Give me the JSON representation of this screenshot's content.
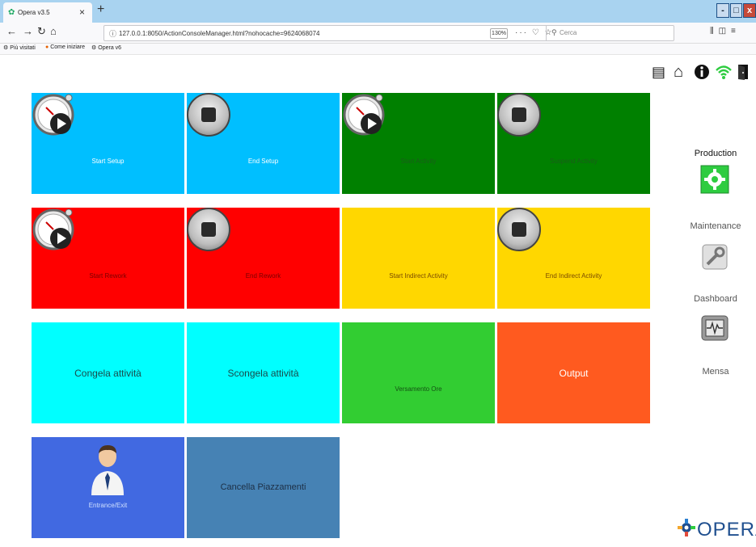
{
  "browser": {
    "tab_title": "Opera v3.5",
    "tab_close": "×",
    "tab_new": "+",
    "window_controls": [
      "-",
      "□",
      "x"
    ],
    "url": "127.0.0.1:8050/ActionConsoleManager.html?nohocache=9624068074",
    "zoom": "130%",
    "url_icons": "··· ♡ ☆",
    "search_placeholder": "Cerca",
    "bookmarks": [
      {
        "label": "Più visitati",
        "icon": "gear-icon"
      },
      {
        "label": "Come iniziare",
        "icon": "firefox-icon"
      },
      {
        "label": "Opera v6",
        "icon": "opera-icon"
      }
    ]
  },
  "top_icons": [
    "note-icon",
    "home-icon",
    "info-icon",
    "wifi-icon",
    "exit-door-icon"
  ],
  "tiles": [
    {
      "label": "Start Setup",
      "color": "#00bfff",
      "icon": "clock-play-icon"
    },
    {
      "label": "End Setup",
      "color": "#00bfff",
      "icon": "stop-icon"
    },
    {
      "label": "Start Activity",
      "color": "#008000",
      "icon": "clock-play-icon"
    },
    {
      "label": "Suspend Activity",
      "color": "#008000",
      "icon": "stop-icon"
    },
    {
      "label": "Start Rework",
      "color": "#ff0000",
      "icon": "clock-play-icon"
    },
    {
      "label": "End Rework",
      "color": "#ff0000",
      "icon": "stop-icon"
    },
    {
      "label": "Start Indirect Activity",
      "color": "#ffd700",
      "icon": ""
    },
    {
      "label": "End Indirect Activity",
      "color": "#ffd700",
      "icon": "stop-icon"
    },
    {
      "label": "Congela attività",
      "color": "#00ffff",
      "icon": ""
    },
    {
      "label": "Scongela attività",
      "color": "#00ffff",
      "icon": ""
    },
    {
      "label": "Versamento Ore",
      "color": "#32cd32",
      "icon": ""
    },
    {
      "label": "Output",
      "color": "#ff5a1f",
      "icon": ""
    },
    {
      "label": "Entrance/Exit",
      "color": "#4169e1",
      "icon": "person-icon"
    },
    {
      "label": "Cancella Piazzamenti",
      "color": "#4682b4",
      "icon": ""
    }
  ],
  "side_menu": [
    {
      "label": "Production",
      "icon": "gear-icon",
      "active": true
    },
    {
      "label": "Maintenance",
      "icon": "wrench-icon",
      "active": false
    },
    {
      "label": "Dashboard",
      "icon": "monitor-icon",
      "active": false
    },
    {
      "label": "Mensa",
      "icon": "",
      "active": false
    }
  ],
  "logo": {
    "text": "OPERA"
  }
}
